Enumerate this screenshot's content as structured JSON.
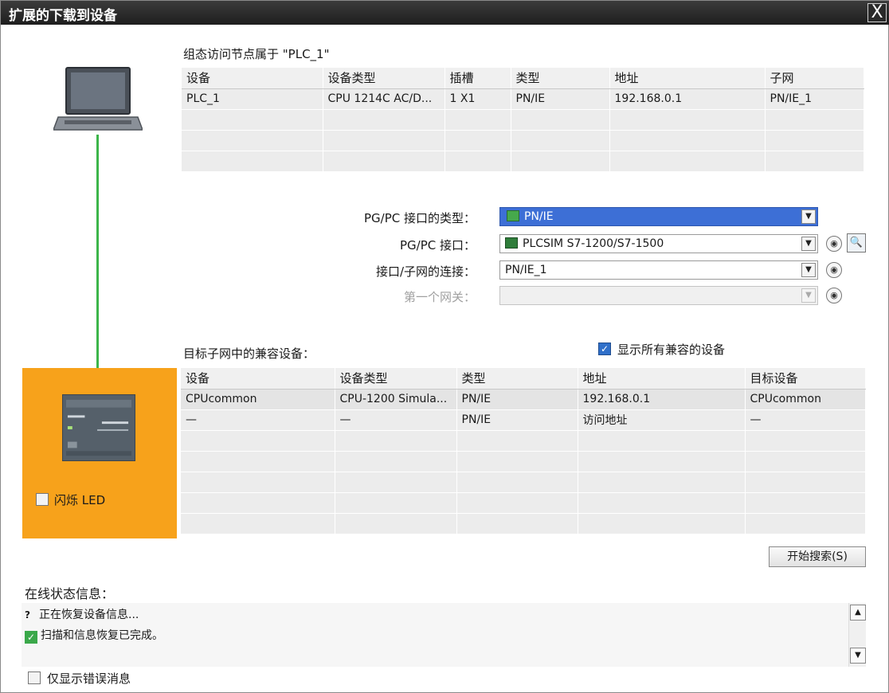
{
  "window": {
    "title": "扩展的下载到设备",
    "close_glyph": "X"
  },
  "config_section": {
    "heading": "组态访问节点属于 \"PLC_1\"",
    "columns": [
      "设备",
      "设备类型",
      "插槽",
      "类型",
      "地址",
      "子网"
    ],
    "rows": [
      [
        "PLC_1",
        "CPU 1214C AC/D...",
        "1 X1",
        "PN/IE",
        "192.168.0.1",
        "PN/IE_1"
      ]
    ]
  },
  "interface": {
    "type_label": "PG/PC 接口的类型：",
    "type_value": "PN/IE",
    "iface_label": "PG/PC 接口：",
    "iface_value": "PLCSIM S7-1200/S7-1500",
    "subnet_label": "接口/子网的连接：",
    "subnet_value": "PN/IE_1",
    "gateway_label": "第一个网关：",
    "gateway_value": ""
  },
  "target_section": {
    "heading": "目标子网中的兼容设备：",
    "show_all_label": "显示所有兼容的设备",
    "show_all_checked": true,
    "columns": [
      "设备",
      "设备类型",
      "类型",
      "地址",
      "目标设备"
    ],
    "rows": [
      [
        "CPUcommon",
        "CPU-1200 Simula...",
        "PN/IE",
        "192.168.0.1",
        "CPUcommon"
      ],
      [
        "—",
        "—",
        "PN/IE",
        "访问地址",
        "—"
      ]
    ]
  },
  "plc_panel": {
    "flash_led_label": "闪烁 LED",
    "flash_led_checked": false
  },
  "search_button": "开始搜索(S)",
  "status": {
    "heading": "在线状态信息：",
    "lines": [
      {
        "icon": "search-progress-icon",
        "text": "正在恢复设备信息..."
      },
      {
        "icon": "check-icon",
        "text": "扫描和信息恢复已完成。"
      }
    ],
    "only_errors_label": "仅显示错误消息",
    "only_errors_checked": false
  },
  "colors": {
    "plc_panel": "#f7a21b",
    "cable": "#3cb54a",
    "highlight": "#3d6fd6"
  }
}
